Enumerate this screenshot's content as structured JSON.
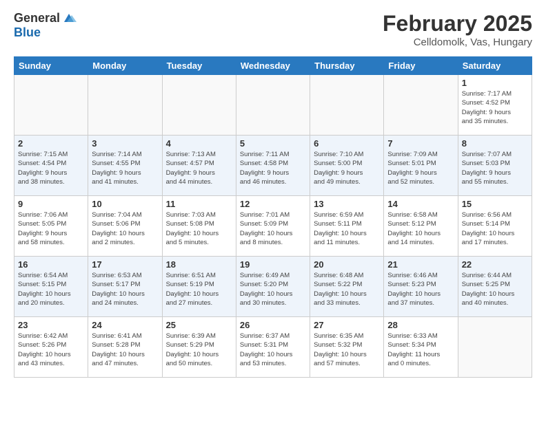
{
  "logo": {
    "general": "General",
    "blue": "Blue"
  },
  "title": "February 2025",
  "subtitle": "Celldomolk, Vas, Hungary",
  "headers": [
    "Sunday",
    "Monday",
    "Tuesday",
    "Wednesday",
    "Thursday",
    "Friday",
    "Saturday"
  ],
  "weeks": [
    [
      {
        "day": "",
        "info": ""
      },
      {
        "day": "",
        "info": ""
      },
      {
        "day": "",
        "info": ""
      },
      {
        "day": "",
        "info": ""
      },
      {
        "day": "",
        "info": ""
      },
      {
        "day": "",
        "info": ""
      },
      {
        "day": "1",
        "info": "Sunrise: 7:17 AM\nSunset: 4:52 PM\nDaylight: 9 hours\nand 35 minutes."
      }
    ],
    [
      {
        "day": "2",
        "info": "Sunrise: 7:15 AM\nSunset: 4:54 PM\nDaylight: 9 hours\nand 38 minutes."
      },
      {
        "day": "3",
        "info": "Sunrise: 7:14 AM\nSunset: 4:55 PM\nDaylight: 9 hours\nand 41 minutes."
      },
      {
        "day": "4",
        "info": "Sunrise: 7:13 AM\nSunset: 4:57 PM\nDaylight: 9 hours\nand 44 minutes."
      },
      {
        "day": "5",
        "info": "Sunrise: 7:11 AM\nSunset: 4:58 PM\nDaylight: 9 hours\nand 46 minutes."
      },
      {
        "day": "6",
        "info": "Sunrise: 7:10 AM\nSunset: 5:00 PM\nDaylight: 9 hours\nand 49 minutes."
      },
      {
        "day": "7",
        "info": "Sunrise: 7:09 AM\nSunset: 5:01 PM\nDaylight: 9 hours\nand 52 minutes."
      },
      {
        "day": "8",
        "info": "Sunrise: 7:07 AM\nSunset: 5:03 PM\nDaylight: 9 hours\nand 55 minutes."
      }
    ],
    [
      {
        "day": "9",
        "info": "Sunrise: 7:06 AM\nSunset: 5:05 PM\nDaylight: 9 hours\nand 58 minutes."
      },
      {
        "day": "10",
        "info": "Sunrise: 7:04 AM\nSunset: 5:06 PM\nDaylight: 10 hours\nand 2 minutes."
      },
      {
        "day": "11",
        "info": "Sunrise: 7:03 AM\nSunset: 5:08 PM\nDaylight: 10 hours\nand 5 minutes."
      },
      {
        "day": "12",
        "info": "Sunrise: 7:01 AM\nSunset: 5:09 PM\nDaylight: 10 hours\nand 8 minutes."
      },
      {
        "day": "13",
        "info": "Sunrise: 6:59 AM\nSunset: 5:11 PM\nDaylight: 10 hours\nand 11 minutes."
      },
      {
        "day": "14",
        "info": "Sunrise: 6:58 AM\nSunset: 5:12 PM\nDaylight: 10 hours\nand 14 minutes."
      },
      {
        "day": "15",
        "info": "Sunrise: 6:56 AM\nSunset: 5:14 PM\nDaylight: 10 hours\nand 17 minutes."
      }
    ],
    [
      {
        "day": "16",
        "info": "Sunrise: 6:54 AM\nSunset: 5:15 PM\nDaylight: 10 hours\nand 20 minutes."
      },
      {
        "day": "17",
        "info": "Sunrise: 6:53 AM\nSunset: 5:17 PM\nDaylight: 10 hours\nand 24 minutes."
      },
      {
        "day": "18",
        "info": "Sunrise: 6:51 AM\nSunset: 5:19 PM\nDaylight: 10 hours\nand 27 minutes."
      },
      {
        "day": "19",
        "info": "Sunrise: 6:49 AM\nSunset: 5:20 PM\nDaylight: 10 hours\nand 30 minutes."
      },
      {
        "day": "20",
        "info": "Sunrise: 6:48 AM\nSunset: 5:22 PM\nDaylight: 10 hours\nand 33 minutes."
      },
      {
        "day": "21",
        "info": "Sunrise: 6:46 AM\nSunset: 5:23 PM\nDaylight: 10 hours\nand 37 minutes."
      },
      {
        "day": "22",
        "info": "Sunrise: 6:44 AM\nSunset: 5:25 PM\nDaylight: 10 hours\nand 40 minutes."
      }
    ],
    [
      {
        "day": "23",
        "info": "Sunrise: 6:42 AM\nSunset: 5:26 PM\nDaylight: 10 hours\nand 43 minutes."
      },
      {
        "day": "24",
        "info": "Sunrise: 6:41 AM\nSunset: 5:28 PM\nDaylight: 10 hours\nand 47 minutes."
      },
      {
        "day": "25",
        "info": "Sunrise: 6:39 AM\nSunset: 5:29 PM\nDaylight: 10 hours\nand 50 minutes."
      },
      {
        "day": "26",
        "info": "Sunrise: 6:37 AM\nSunset: 5:31 PM\nDaylight: 10 hours\nand 53 minutes."
      },
      {
        "day": "27",
        "info": "Sunrise: 6:35 AM\nSunset: 5:32 PM\nDaylight: 10 hours\nand 57 minutes."
      },
      {
        "day": "28",
        "info": "Sunrise: 6:33 AM\nSunset: 5:34 PM\nDaylight: 11 hours\nand 0 minutes."
      },
      {
        "day": "",
        "info": ""
      }
    ]
  ]
}
